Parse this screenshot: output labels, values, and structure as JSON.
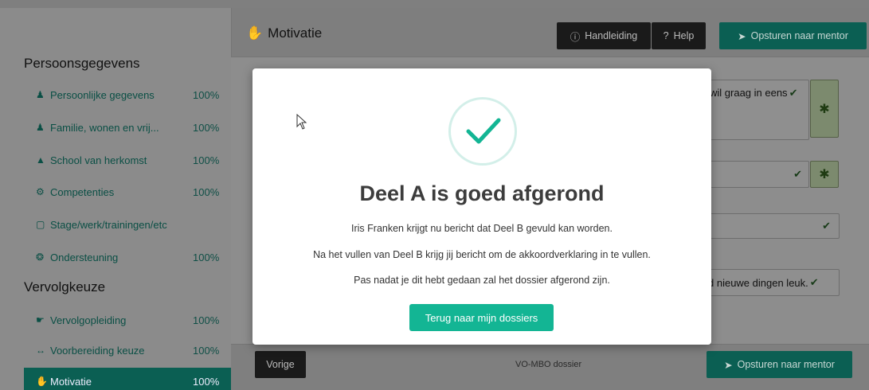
{
  "header": {
    "page_title": "Motivatie",
    "manual_label": "Handleiding",
    "help_label": "Help",
    "send_label": "Opsturen naar mentor"
  },
  "sidebar": {
    "section1": "Persoonsgegevens",
    "section2": "Vervolgkeuze",
    "items": [
      {
        "label": "Persoonlijke gegevens",
        "pct": "100%",
        "icon": "user-icon"
      },
      {
        "label": "Familie, wonen en vrij...",
        "pct": "100%",
        "icon": "users-icon"
      },
      {
        "label": "School van herkomst",
        "pct": "100%",
        "icon": "graduation-cap-icon"
      },
      {
        "label": "Competenties",
        "pct": "100%",
        "icon": "gears-icon"
      },
      {
        "label": "Stage/werk/trainingen/etc",
        "pct": "",
        "icon": "briefcase-icon"
      },
      {
        "label": "Ondersteuning",
        "pct": "100%",
        "icon": "lifebuoy-icon"
      },
      {
        "label": "Vervolgopleiding",
        "pct": "100%",
        "icon": "hand-pointer-icon"
      },
      {
        "label": "Voorbereiding keuze",
        "pct": "100%",
        "icon": "arrows-horizontal-icon"
      },
      {
        "label": "Motivatie",
        "pct": "100%",
        "icon": "thumbs-up-icon"
      }
    ]
  },
  "form": {
    "field1_text": "wil graag in eens",
    "field4_text": "d nieuwe dingen leuk."
  },
  "footer": {
    "prev_label": "Vorige",
    "dossier_label": "VO-MBO dossier",
    "send_label": "Opsturen naar mentor"
  },
  "modal": {
    "title": "Deel A is goed afgerond",
    "line1": "Iris Franken krijgt nu bericht dat Deel B gevuld kan worden.",
    "line2": "Na het vullen van Deel B krijg jij bericht om de akkoordverklaring in te vullen.",
    "line3": "Pas nadat je dit hebt gedaan zal het dossier afgerond zijn.",
    "button_label": "Terug naar mijn dossiers"
  },
  "colors": {
    "accent": "#13b594",
    "check": "#13b594"
  }
}
